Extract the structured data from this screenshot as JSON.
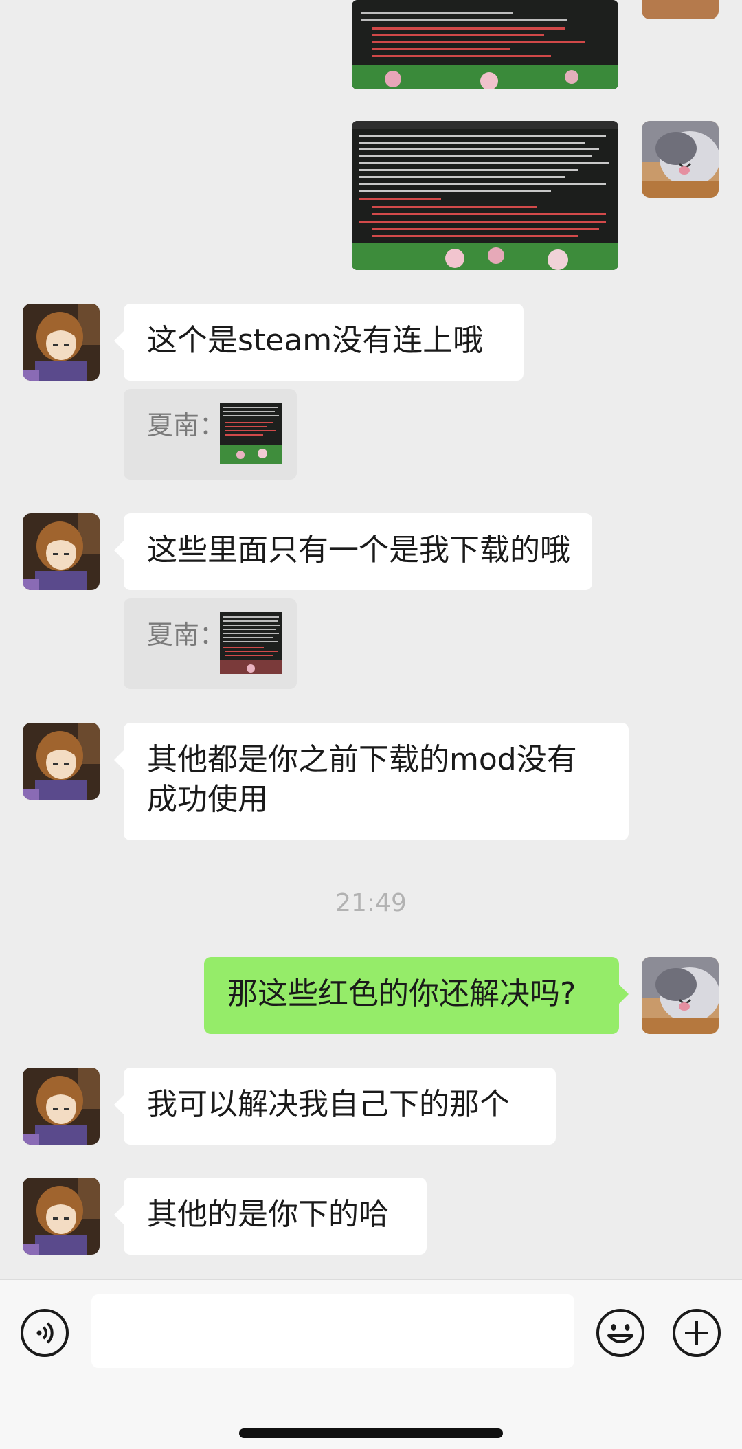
{
  "messages": [
    {
      "sender": "other",
      "text": "这个是steam没有连上哦"
    },
    {
      "quote_name": "夏南："
    },
    {
      "sender": "other",
      "text": "这些里面只有一个是我下载的哦"
    },
    {
      "quote_name": "夏南："
    },
    {
      "sender": "other",
      "text_line1": "其他都是你之前下载的mod没有",
      "text_line2": "成功使用"
    },
    {
      "timestamp": "21:49"
    },
    {
      "sender": "me",
      "text": "那这些红色的你还解决吗?"
    },
    {
      "sender": "other",
      "text": "我可以解决我自己下的那个"
    },
    {
      "sender": "other",
      "text": "其他的是你下的哈"
    }
  ],
  "colors": {
    "background": "#ededed",
    "my_bubble": "#95ec69",
    "other_bubble": "#ffffff",
    "timestamp": "#b2b2b2"
  },
  "toolbar": {
    "icons": [
      "voice-icon",
      "emoji-icon",
      "plus-icon"
    ]
  }
}
